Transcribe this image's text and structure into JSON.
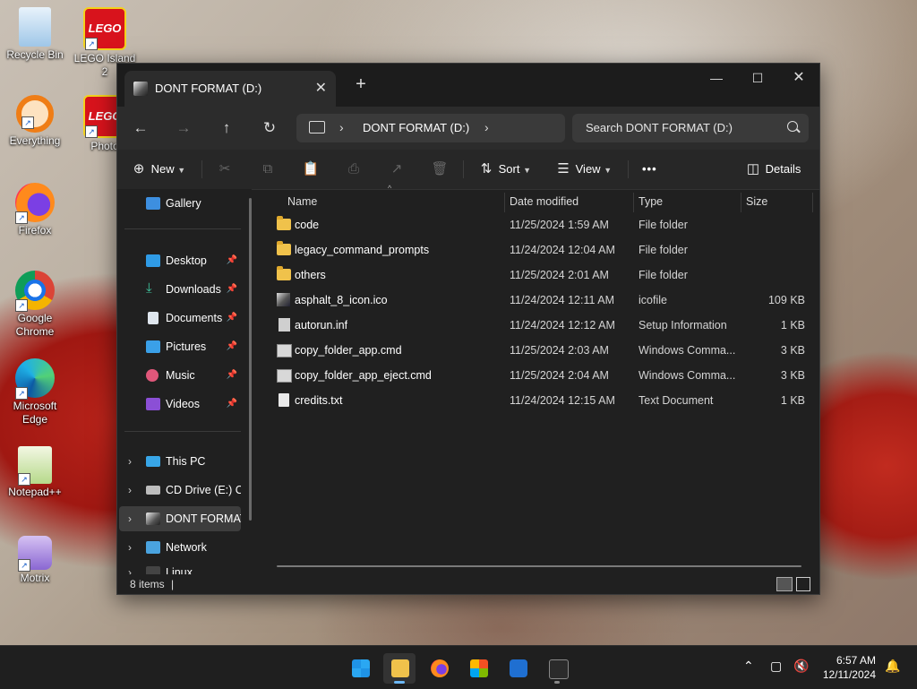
{
  "desktop": {
    "icons": [
      {
        "label": "Recycle Bin"
      },
      {
        "label": "LEGO Island 2"
      },
      {
        "label": "Everything"
      },
      {
        "label": "Photo"
      },
      {
        "label": "Firefox"
      },
      {
        "label": "Google Chrome"
      },
      {
        "label": "Microsoft Edge"
      },
      {
        "label": "Notepad++"
      },
      {
        "label": "Motrix"
      }
    ],
    "lego_text": "LEGO"
  },
  "window": {
    "tab_title": "DONT FORMAT (D:)",
    "address": {
      "location": "DONT FORMAT (D:)"
    },
    "search": {
      "placeholder": "Search DONT FORMAT (D:)"
    },
    "toolbar": {
      "new": "New",
      "sort": "Sort",
      "view": "View",
      "more": "•••",
      "details": "Details"
    }
  },
  "sidebar": {
    "items": [
      {
        "label": "Gallery"
      },
      {
        "label": "Desktop"
      },
      {
        "label": "Downloads"
      },
      {
        "label": "Documents"
      },
      {
        "label": "Pictures"
      },
      {
        "label": "Music"
      },
      {
        "label": "Videos"
      },
      {
        "label": "This PC"
      },
      {
        "label": "CD Drive (E:) CD"
      },
      {
        "label": "DONT FORMAT"
      },
      {
        "label": "Network"
      },
      {
        "label": "Linux"
      }
    ]
  },
  "columns": {
    "name": "Name",
    "date": "Date modified",
    "type": "Type",
    "size": "Size"
  },
  "files": [
    {
      "name": "code",
      "date": "11/25/2024 1:59 AM",
      "type": "File folder",
      "size": ""
    },
    {
      "name": "legacy_command_prompts",
      "date": "11/24/2024 12:04 AM",
      "type": "File folder",
      "size": ""
    },
    {
      "name": "others",
      "date": "11/25/2024 2:01 AM",
      "type": "File folder",
      "size": ""
    },
    {
      "name": "asphalt_8_icon.ico",
      "date": "11/24/2024 12:11 AM",
      "type": "icofile",
      "size": "109 KB"
    },
    {
      "name": "autorun.inf",
      "date": "11/24/2024 12:12 AM",
      "type": "Setup Information",
      "size": "1 KB"
    },
    {
      "name": "copy_folder_app.cmd",
      "date": "11/25/2024 2:03 AM",
      "type": "Windows Comma...",
      "size": "3 KB"
    },
    {
      "name": "copy_folder_app_eject.cmd",
      "date": "11/25/2024 2:04 AM",
      "type": "Windows Comma...",
      "size": "3 KB"
    },
    {
      "name": "credits.txt",
      "date": "11/24/2024 12:15 AM",
      "type": "Text Document",
      "size": "1 KB"
    }
  ],
  "status": {
    "items": "8 items"
  },
  "taskbar": {
    "time": "6:57 AM",
    "date": "12/11/2024"
  },
  "colors": {
    "accent": "#6cb8f6",
    "folder": "#f0c24b",
    "window_bg": "#202020"
  }
}
